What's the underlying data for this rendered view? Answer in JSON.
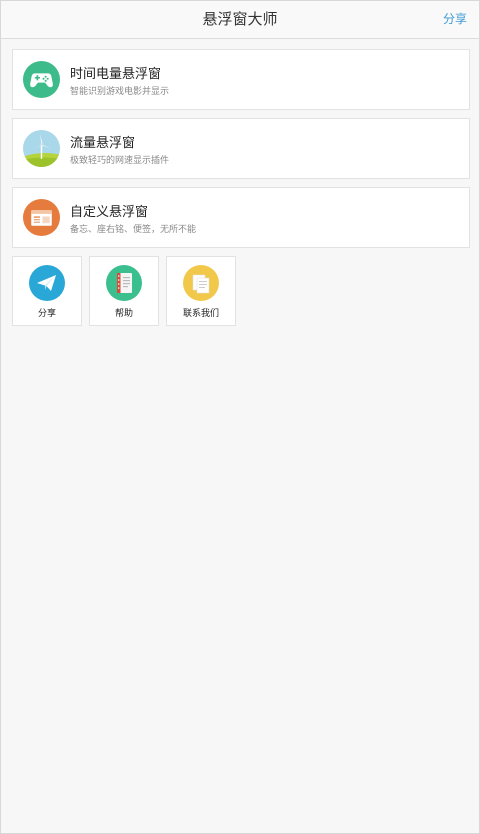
{
  "header": {
    "title": "悬浮窗大师",
    "share_label": "分享"
  },
  "cards": [
    {
      "title": "时间电量悬浮窗",
      "subtitle": "智能识别游戏电影并显示",
      "icon": "gamepad-icon",
      "icon_color": "#3dbb8a"
    },
    {
      "title": "流量悬浮窗",
      "subtitle": "极致轻巧的网速显示插件",
      "icon": "windmill-icon",
      "icon_color": "#9ed3e6"
    },
    {
      "title": "自定义悬浮窗",
      "subtitle": "备忘、座右铭、便签，无所不能",
      "icon": "notepad-icon",
      "icon_color": "#e57b3c"
    }
  ],
  "tiles": [
    {
      "label": "分享",
      "icon": "paper-plane-icon",
      "icon_color": "#29a8d8"
    },
    {
      "label": "帮助",
      "icon": "notebook-icon",
      "icon_color": "#3cbf8f"
    },
    {
      "label": "联系我们",
      "icon": "documents-icon",
      "icon_color": "#f2c84b"
    }
  ]
}
